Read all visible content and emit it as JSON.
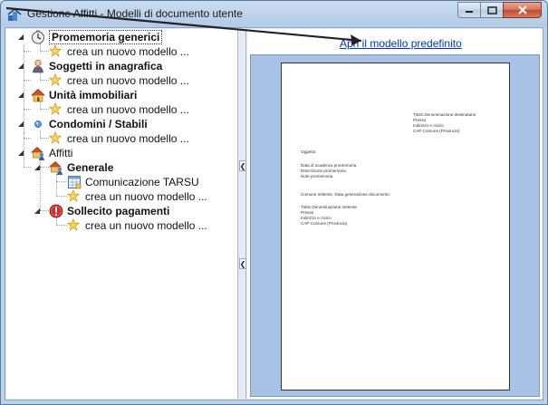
{
  "window": {
    "title": "Gestione Affitti - Modelli di documento utente"
  },
  "tree": {
    "nodes": [
      {
        "label": "Promemoria generici",
        "icon": "clock-icon"
      },
      {
        "label": "crea un nuovo modello ...",
        "icon": "star-icon"
      },
      {
        "label": "Soggetti in anagrafica",
        "icon": "person-icon"
      },
      {
        "label": "crea un nuovo modello ...",
        "icon": "star-icon"
      },
      {
        "label": "Unità immobiliari",
        "icon": "house-icon"
      },
      {
        "label": "crea un nuovo modello ...",
        "icon": "star-icon"
      },
      {
        "label": "Condomini / Stabili",
        "icon": "building-icon"
      },
      {
        "label": "crea un nuovo modello ...",
        "icon": "star-icon"
      },
      {
        "label": "Affitti",
        "icon": "house-people-icon"
      },
      {
        "label": "Generale",
        "icon": "house-people-icon"
      },
      {
        "label": "Comunicazione TARSU",
        "icon": "document-grid-icon"
      },
      {
        "label": "crea un nuovo modello ...",
        "icon": "star-icon"
      },
      {
        "label": "Sollecito pagamenti",
        "icon": "warning-icon"
      },
      {
        "label": "crea un nuovo modello ...",
        "icon": "star-icon"
      }
    ]
  },
  "preview": {
    "link_label": "Apri il modello predefinito",
    "lines": [
      "Titolo Denominazione destinatario",
      "Presso",
      "Indirizzo e civico",
      "CAP Comune (Provincia)",
      "Oggetto:",
      "Data di scadenza promemoria",
      "Descrizione promemoria",
      "Note promemoria",
      "Comune mittente, Data generazione documento",
      "Titolo Denominazione mittente",
      "Presso",
      "Indirizzo e civico",
      "CAP Comune (Provincia)"
    ]
  }
}
